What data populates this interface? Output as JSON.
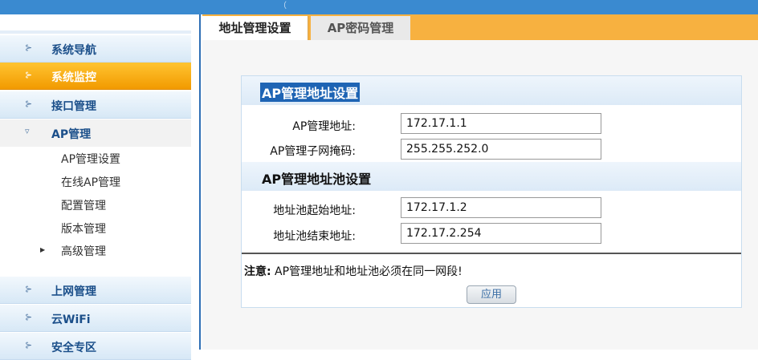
{
  "topbar": {
    "glyph": "（"
  },
  "sidebar": {
    "items": [
      {
        "label": "系统导航",
        "arrow": "⊱"
      },
      {
        "label": "系统监控",
        "arrow": "⊱"
      },
      {
        "label": "接口管理",
        "arrow": "⊱"
      },
      {
        "label": "AP管理",
        "arrow": "▿"
      }
    ],
    "subitems": [
      "AP管理设置",
      "在线AP管理",
      "配置管理",
      "版本管理",
      "高级管理"
    ],
    "sub_arrow": "▶",
    "items_after": [
      {
        "label": "上网管理",
        "arrow": "⊱"
      },
      {
        "label": "云WiFi",
        "arrow": "⊱"
      },
      {
        "label": "安全专区",
        "arrow": "⊱"
      }
    ]
  },
  "tabs": [
    "地址管理设置",
    "AP密码管理"
  ],
  "panel": {
    "section1_title": "AP管理地址设置",
    "ap_addr_label": "AP管理地址:",
    "ap_addr_value": "172.17.1.1",
    "ap_mask_label": "AP管理子网掩码:",
    "ap_mask_value": "255.255.252.0",
    "section2_title": "AP管理地址池设置",
    "pool_start_label": "地址池起始地址:",
    "pool_start_value": "172.17.1.2",
    "pool_end_label": "地址池结束地址:",
    "pool_end_value": "172.17.2.254",
    "note_prefix": "注意:",
    "note_text": " AP管理地址和地址池必须在同一网段!",
    "apply_label": "应用"
  }
}
